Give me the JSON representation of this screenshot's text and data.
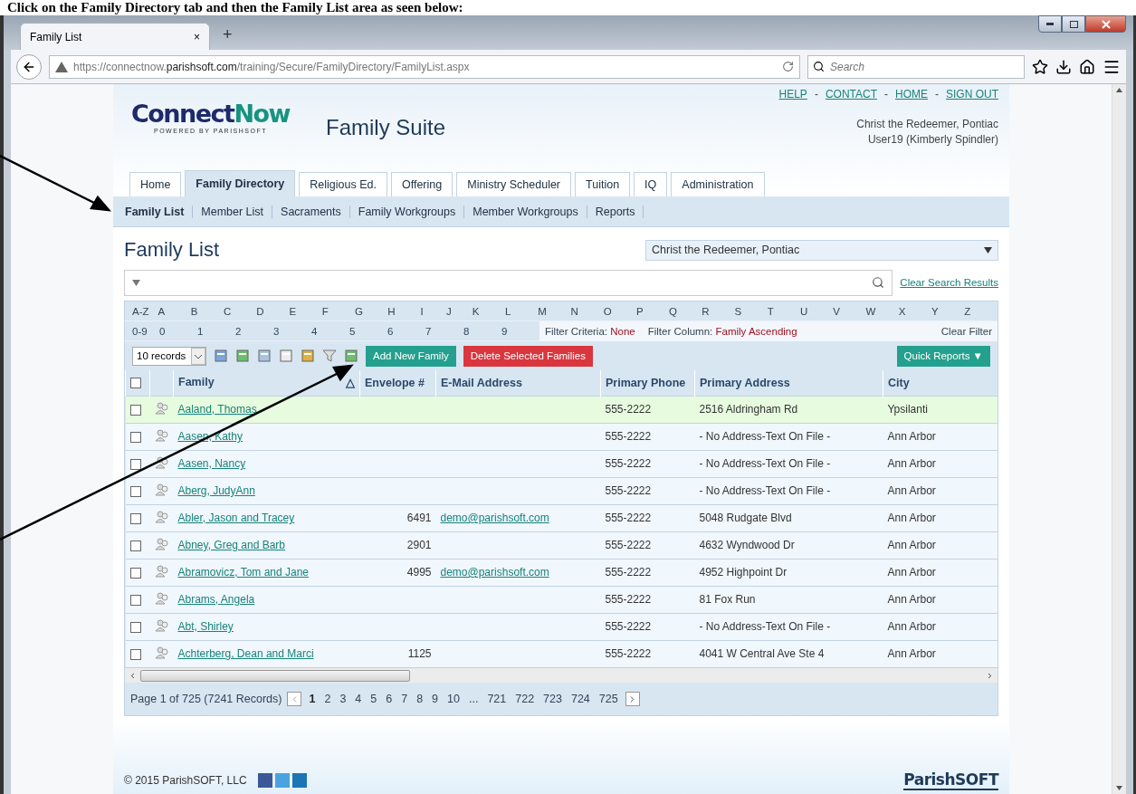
{
  "caption": "Click on the Family Directory tab and then the Family List area as seen below:",
  "browser": {
    "tab_title": "Family List",
    "tab_close": "×",
    "new_tab": "+",
    "url": "https://connectnow.**parishsoft.com**/training/Secure/FamilyDirectory/FamilyList.aspx",
    "search_placeholder": "Search"
  },
  "header": {
    "links": [
      "HELP",
      "CONTACT",
      "HOME",
      "SIGN OUT"
    ],
    "separator": "-",
    "logo": {
      "word1": "Connect",
      "word2": "Now",
      "tagline": "POWERED BY PARISHSOFT"
    },
    "suite_title": "Family Suite",
    "org": "Christ the Redeemer, Pontiac",
    "user": "User19 (Kimberly Spindler)"
  },
  "tabs": [
    {
      "label": "Home",
      "selected": false
    },
    {
      "label": "Family Directory",
      "selected": true
    },
    {
      "label": "Religious Ed.",
      "selected": false
    },
    {
      "label": "Offering",
      "selected": false
    },
    {
      "label": "Ministry Scheduler",
      "selected": false
    },
    {
      "label": "Tuition",
      "selected": false
    },
    {
      "label": "IQ",
      "selected": false
    },
    {
      "label": "Administration",
      "selected": false
    }
  ],
  "subtabs": [
    {
      "label": "Family List",
      "selected": true
    },
    {
      "label": "Member List",
      "selected": false
    },
    {
      "label": "Sacraments",
      "selected": false
    },
    {
      "label": "Family Workgroups",
      "selected": false
    },
    {
      "label": "Member Workgroups",
      "selected": false
    },
    {
      "label": "Reports",
      "selected": false
    }
  ],
  "page_title": "Family List",
  "org_select": "Christ the Redeemer, Pontiac",
  "clear_search": "Clear Search Results",
  "letters": [
    "A-Z",
    "A",
    "B",
    "C",
    "D",
    "E",
    "F",
    "G",
    "H",
    "I",
    "J",
    "K",
    "L",
    "M",
    "N",
    "O",
    "P",
    "Q",
    "R",
    "S",
    "T",
    "U",
    "V",
    "W",
    "X",
    "Y",
    "Z"
  ],
  "digits": [
    "0-9",
    "0",
    "1",
    "2",
    "3",
    "4",
    "5",
    "6",
    "7",
    "8",
    "9"
  ],
  "filter_criteria": {
    "label": "Filter Criteria:",
    "value": "None"
  },
  "filter_column": {
    "label": "Filter Column:",
    "value": "Family Ascending"
  },
  "clear_filter": "Clear Filter",
  "records_select": "10 records",
  "add_button": "Add New Family",
  "delete_button": "Delete Selected Families",
  "quick_reports": "Quick Reports ▼",
  "select_all_checked": false,
  "columns": [
    "Family",
    "Envelope #",
    "E-Mail Address",
    "Primary Phone",
    "Primary Address",
    "City"
  ],
  "sort_mark": "△",
  "rows": [
    {
      "family": "Aaland, Thomas",
      "envelope": "",
      "email": "",
      "phone": "555-2222",
      "address": "2516 Aldringham Rd",
      "city": "Ypsilanti",
      "selected": true,
      "checked": false
    },
    {
      "family": "Aasen, Kathy",
      "envelope": "",
      "email": "",
      "phone": "555-2222",
      "address": "- No Address-Text On File -",
      "city": "Ann Arbor",
      "selected": false,
      "checked": false
    },
    {
      "family": "Aasen, Nancy",
      "envelope": "",
      "email": "",
      "phone": "555-2222",
      "address": "- No Address-Text On File -",
      "city": "Ann Arbor",
      "selected": false,
      "checked": false
    },
    {
      "family": "Aberg, JudyAnn",
      "envelope": "",
      "email": "",
      "phone": "555-2222",
      "address": "- No Address-Text On File -",
      "city": "Ann Arbor",
      "selected": false,
      "checked": false
    },
    {
      "family": "Abler, Jason and Tracey",
      "envelope": "6491",
      "email": "demo@parishsoft.com",
      "phone": "555-2222",
      "address": "5048 Rudgate Blvd",
      "city": "Ann Arbor",
      "selected": false,
      "checked": false
    },
    {
      "family": "Abney, Greg and Barb",
      "envelope": "2901",
      "email": "",
      "phone": "555-2222",
      "address": "4632 Wyndwood Dr",
      "city": "Ann Arbor",
      "selected": false,
      "checked": false
    },
    {
      "family": "Abramovicz, Tom and Jane",
      "envelope": "4995",
      "email": "demo@parishsoft.com",
      "phone": "555-2222",
      "address": "4952 Highpoint Dr",
      "city": "Ann Arbor",
      "selected": false,
      "checked": false
    },
    {
      "family": "Abrams, Angela",
      "envelope": "",
      "email": "",
      "phone": "555-2222",
      "address": "81 Fox Run",
      "city": "Ann Arbor",
      "selected": false,
      "checked": false
    },
    {
      "family": "Abt, Shirley",
      "envelope": "",
      "email": "",
      "phone": "555-2222",
      "address": "- No Address-Text On File -",
      "city": "Ann Arbor",
      "selected": false,
      "checked": false
    },
    {
      "family": "Achterberg, Dean and Marci",
      "envelope": "1125",
      "email": "",
      "phone": "555-2222",
      "address": "4041 W Central Ave Ste 4",
      "city": "Ann Arbor",
      "selected": false,
      "checked": false
    }
  ],
  "pager": {
    "summary": "Page 1 of 725 (7241 Records)",
    "pages": [
      {
        "label": "1",
        "selected": true
      },
      {
        "label": "2",
        "selected": false
      },
      {
        "label": "3",
        "selected": false
      },
      {
        "label": "4",
        "selected": false
      },
      {
        "label": "5",
        "selected": false
      },
      {
        "label": "6",
        "selected": false
      },
      {
        "label": "7",
        "selected": false
      },
      {
        "label": "8",
        "selected": false
      },
      {
        "label": "9",
        "selected": false
      },
      {
        "label": "10",
        "selected": false
      },
      {
        "label": "...",
        "selected": false
      },
      {
        "label": "721",
        "selected": false
      },
      {
        "label": "722",
        "selected": false
      },
      {
        "label": "723",
        "selected": false
      },
      {
        "label": "724",
        "selected": false
      },
      {
        "label": "725",
        "selected": false
      }
    ]
  },
  "footer": {
    "copyright": "© 2015 ParishSOFT, LLC",
    "brand": "ParishSOFT"
  }
}
